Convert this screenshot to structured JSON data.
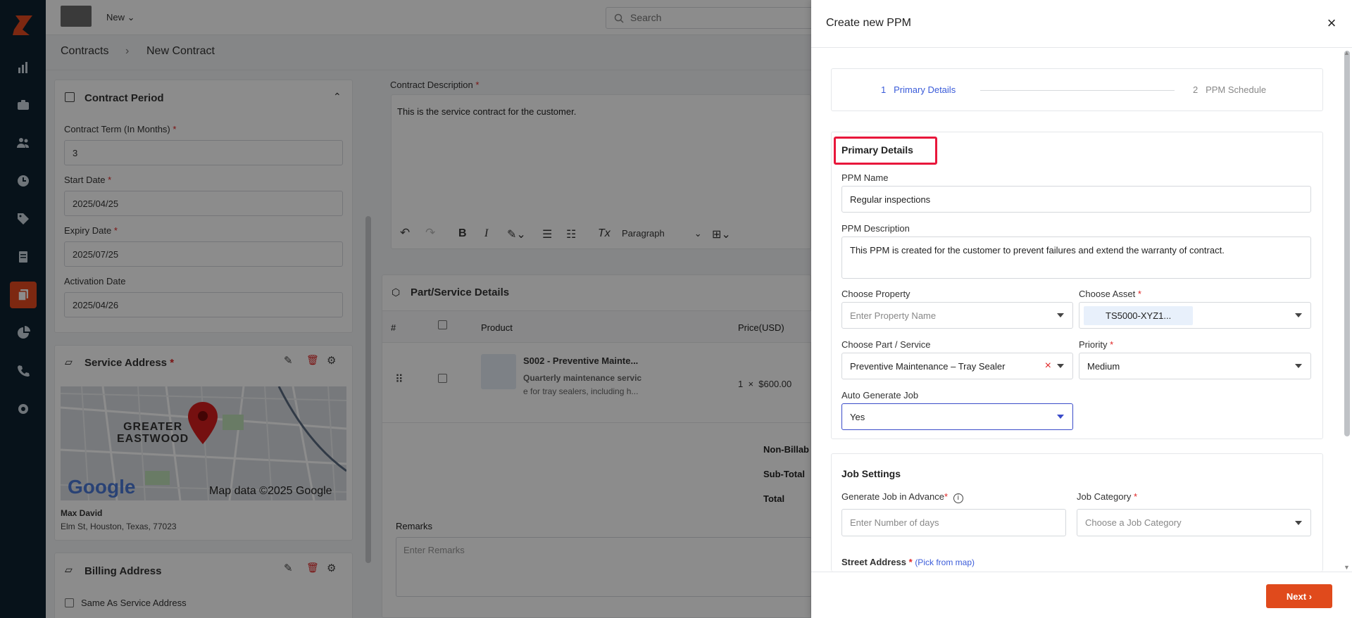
{
  "topbar": {
    "new_label": "New",
    "search_placeholder": "Search"
  },
  "breadcrumb": {
    "root": "Contracts",
    "current": "New Contract"
  },
  "contract_period": {
    "title": "Contract Period",
    "term_label": "Contract Term (In Months)",
    "term_value": "3",
    "start_label": "Start Date",
    "start_value": "2025/04/25",
    "expiry_label": "Expiry Date",
    "expiry_value": "2025/07/25",
    "activation_label": "Activation Date",
    "activation_value": "2025/04/26"
  },
  "service_address": {
    "title": "Service Address",
    "map_area": "GREATER\nEASTWOOD",
    "map_brand": "Google",
    "map_credit": "Map data ©2025 Google",
    "name": "Max David",
    "address": "Elm St, Houston, Texas, 77023"
  },
  "billing_address": {
    "title": "Billing Address",
    "same_as": "Same As Service Address"
  },
  "description": {
    "label": "Contract Description",
    "value": "This is the service contract for the customer.",
    "format": "Paragraph"
  },
  "parts": {
    "title": "Part/Service Details",
    "col_num": "#",
    "col_product": "Product",
    "col_price": "Price(USD)",
    "row": {
      "name": "S002 - Preventive Mainte...",
      "desc1": "Quarterly maintenance servic",
      "desc2": "e for tray sealers, including h...",
      "qty_price": "1  ×  $600.00"
    },
    "non_billable": "Non-Billab",
    "subtotal": "Sub-Total",
    "total": "Total",
    "remarks_label": "Remarks",
    "remarks_placeholder": "Enter Remarks"
  },
  "drawer": {
    "title": "Create new PPM",
    "step1": "1   Primary Details",
    "step2": "2   PPM Schedule",
    "section_title": "Primary Details",
    "ppm_name_label": "PPM Name",
    "ppm_name_value": "Regular inspections",
    "ppm_desc_label": "PPM Description",
    "ppm_desc_value": "This PPM is created for the customer to prevent failures and extend the warranty of contract.",
    "property_label": "Choose Property",
    "property_placeholder": "Enter Property Name",
    "asset_label": "Choose Asset",
    "asset_value": "TS5000-XYZ1...",
    "part_label": "Choose Part / Service",
    "part_value": "Preventive Maintenance – Tray Sealer",
    "priority_label": "Priority",
    "priority_value": "Medium",
    "auto_label": "Auto Generate Job",
    "auto_value": "Yes",
    "job_settings_title": "Job Settings",
    "advance_label": "Generate Job in Advance",
    "advance_placeholder": "Enter Number of days",
    "category_label": "Job Category",
    "category_placeholder": "Choose a Job Category",
    "street_label": "Street Address",
    "street_link": "(Pick from map)",
    "next_label": "Next"
  }
}
